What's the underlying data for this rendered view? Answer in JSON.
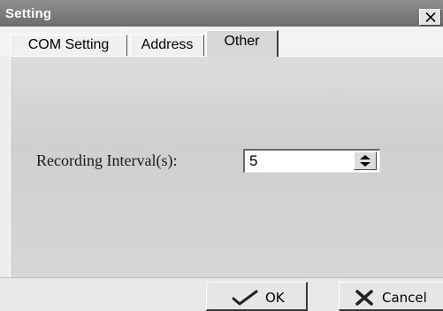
{
  "window": {
    "title": "Setting",
    "close_icon": "close-icon"
  },
  "tabs": [
    {
      "label": "COM Setting",
      "active": false
    },
    {
      "label": "Address",
      "active": false
    },
    {
      "label": "Other",
      "active": true
    }
  ],
  "form": {
    "interval_label": "Recording Interval(s):",
    "interval_value": "5",
    "spinner_icon": "spin-updown-icon"
  },
  "buttons": {
    "ok_label": "OK",
    "ok_icon": "checkmark-icon",
    "cancel_label": "Cancel",
    "cancel_icon": "x-mark-icon"
  },
  "colors": {
    "titlebar": "#7a7a7a",
    "panel": "#d6d6d6",
    "button_face": "#e6e6e6"
  }
}
